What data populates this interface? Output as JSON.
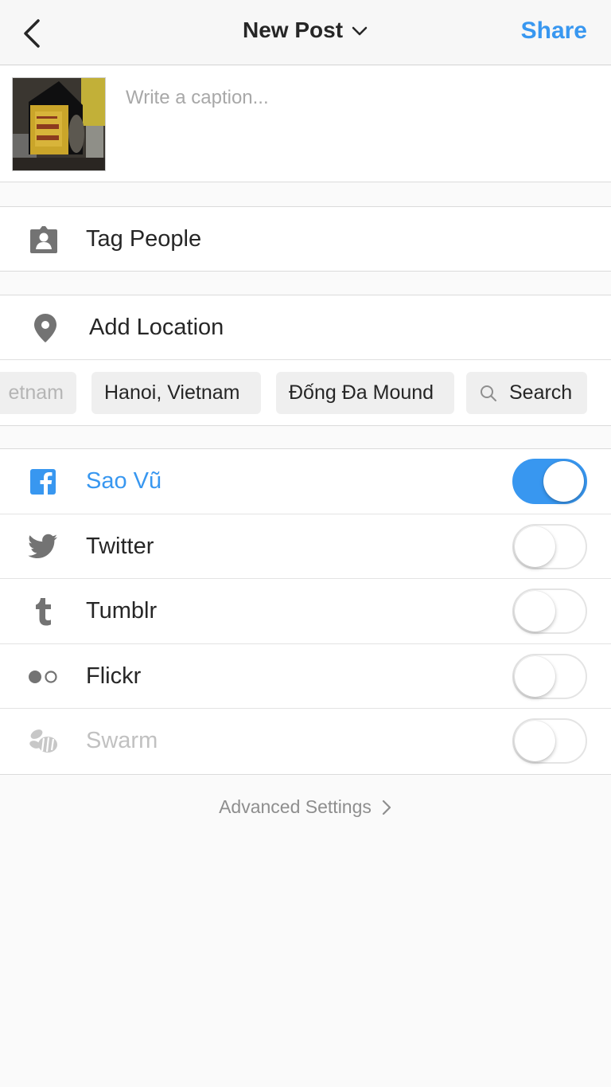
{
  "header": {
    "title": "New Post",
    "share_label": "Share",
    "accent_color": "#3897f0"
  },
  "caption": {
    "placeholder": "Write a caption...",
    "value": ""
  },
  "tag_people": {
    "label": "Tag People",
    "icon": "tag-person-icon"
  },
  "add_location": {
    "label": "Add Location",
    "icon": "location-pin-icon"
  },
  "location_suggestions": [
    {
      "label": "etnam",
      "faded": true
    },
    {
      "label": "Hanoi, Vietnam"
    },
    {
      "label": "Đống Đa Mound"
    },
    {
      "label": "Search",
      "icon": "search-icon"
    }
  ],
  "share_targets": [
    {
      "name": "Sao Vũ",
      "icon": "facebook-icon",
      "enabled": true,
      "style": "fb"
    },
    {
      "name": "Twitter",
      "icon": "twitter-icon",
      "enabled": false
    },
    {
      "name": "Tumblr",
      "icon": "tumblr-icon",
      "enabled": false
    },
    {
      "name": "Flickr",
      "icon": "flickr-icon",
      "enabled": false
    },
    {
      "name": "Swarm",
      "icon": "swarm-icon",
      "enabled": false,
      "style": "disabled"
    }
  ],
  "advanced_settings": {
    "label": "Advanced Settings"
  }
}
